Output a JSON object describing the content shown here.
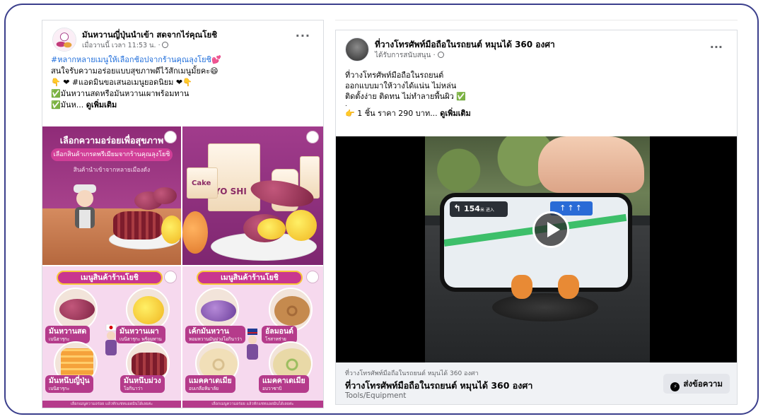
{
  "post1": {
    "page_name": "มันหวานญี่ปุ่นนำเข้า สดจากไร่คุณโยชิ",
    "time": "เมื่อวานนี้ เวลา 11:53 น. ·",
    "more": "···",
    "lines": [
      "#หลากหลายเมนูให้เลือกช้อปจากร้านคุณลุงโยชิ💕",
      "สนใจรับความอร่อยแบบสุขภาพดีไว้สักเมนูมั้ยคะ😄",
      "👇 ❤ #แอดมินขอเสนอเมนูยอดนิยม ❤👇",
      "✅มันหวานสดหรือมันหวานเผาพร้อมทาน",
      "✅มันห..."
    ],
    "see_more": "ดูเพิ่มเติม",
    "promo": {
      "title": "เลือกความอร่อยเพื่อสุขภาพ",
      "pill": "เลือกสินค้าเกรดพรีเมียมจากร้านคุณลุงโยชิ",
      "sub": "สินค้านำเข้าจากหลายเมืองดัง",
      "pack_cake": "Cake",
      "pack_yoshi": "YO SHI",
      "menu_banner_left": "เมนูสินค้าร้านโยชิ",
      "menu_banner_right": "เมนูสินค้าร้านโยชิ",
      "items_left": [
        {
          "name": "มันหวานสด",
          "sub": "เบนิฮารุกะ"
        },
        {
          "name": "มันหวานเผา",
          "sub": "เบนิฮารุกะ พร้อมทาน"
        },
        {
          "name": "มันหนึบญี่ปุ่น",
          "sub": "เบนิฮารุกะ"
        },
        {
          "name": "มันหนึบม่วง",
          "sub": "โอกินาว่า"
        }
      ],
      "items_right": [
        {
          "name": "เค้กมันหวาน",
          "sub": "หอมหวานมันม่วงโอกินาว่า"
        },
        {
          "name": "อัลมอนด์",
          "sub": "โรสาหร่าย"
        },
        {
          "name": "แมคคาเดเมีย",
          "sub": "อบเกลือหิมาลัย"
        },
        {
          "name": "แมคคาเดเมีย",
          "sub": "อบวาซาบิ"
        }
      ],
      "footer_left": "เลือกเมนูความอร่อย แล้วทักแชทแอดมินได้เลยค่ะ",
      "footer_right": "เลือกเมนูความอร่อย แล้วทักแชทแอดมินได้เลยค่ะ"
    }
  },
  "post2": {
    "page_name": "ที่วางโทรศัพท์มือถือในรถยนต์ หมุนได้ 360 องศา",
    "sponsored": "ได้รับการสนับสนุน ·",
    "more": "···",
    "lines": [
      "ที่วางโทรศัพท์มือถือในรถยนต์",
      "ออกแบบมาให้วางได้แน่น ไม่หล่น",
      "ติดตั้งง่าย ติดทน ไม่ทำลายพื้นผิว ✅",
      "."
    ],
    "price_line": "👉 1 ชิ้น ราคา 290 บาท...",
    "see_more": "ดูเพิ่มเติม",
    "video": {
      "distance": "154",
      "unit": "米 进入",
      "lanes": "↑↑↑"
    },
    "cta": {
      "small": "ที่วางโทรศัพท์มือถือในรถยนต์ หมุนได้ 360 องศา",
      "title": "ที่วางโทรศัพท์มือถือในรถยนต์ หมุนได้ 360 องศา",
      "category": "Tools/Equipment",
      "button": "ส่งข้อความ"
    }
  },
  "colors": {
    "frame_border": "#3b3f8c",
    "hashtag": "#216fdb",
    "promo_purple": "#a8428c",
    "muted_text": "#65676b",
    "cta_bg": "#f0f2f5"
  }
}
